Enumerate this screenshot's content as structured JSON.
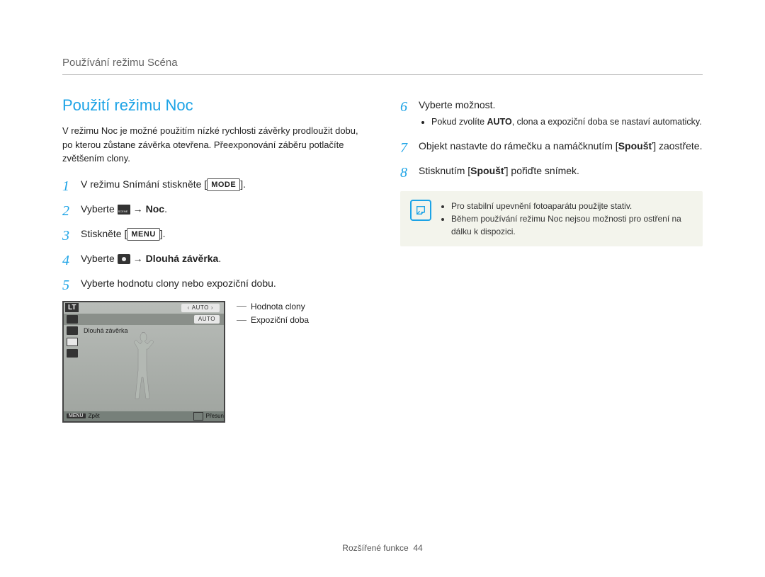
{
  "header": "Používání režimu Scéna",
  "section_title": "Použití režimu Noc",
  "intro": "V režimu Noc je možné použitím nízké rychlosti závěrky prodloužit dobu, po kterou zůstane závěrka otevřena. Přeexponování záběru potlačíte zvětšením clony.",
  "steps": {
    "s1_a": "V režimu Snímání stiskněte [",
    "s1_btn": "MODE",
    "s1_b": "].",
    "s2_a": "Vyberte ",
    "s2_target": "Noc",
    "s3_a": "Stiskněte [",
    "s3_btn": "MENU",
    "s3_b": "].",
    "s4_a": "Vyberte ",
    "s4_target": "Dlouhá závěrka",
    "s5": "Vyberte hodnotu clony nebo expoziční dobu.",
    "s6": "Vyberte možnost.",
    "s6_sub_a": "Pokud zvolíte ",
    "s6_sub_b": "AUTO",
    "s6_sub_c": ", clona a expoziční doba se nastaví automaticky.",
    "s7_a": "Objekt nastavte do rámečku a namáčknutím [",
    "s7_b": "Spoušť",
    "s7_c": "] zaostřete.",
    "s8_a": "Stisknutím [",
    "s8_b": "Spoušť",
    "s8_c": "] pořiďte snímek."
  },
  "lcd": {
    "lt": "LT",
    "auto": "AUTO",
    "long_shutter": "Dlouhá závěrka",
    "menu": "MENU",
    "back": "Zpět",
    "move": "Přesun"
  },
  "callouts": {
    "aperture": "Hodnota clony",
    "exposure": "Expoziční doba"
  },
  "notes": {
    "n1": "Pro stabilní upevnění fotoaparátu použijte stativ.",
    "n2": "Během používání režimu Noc nejsou možnosti pro ostření na dálku k dispozici."
  },
  "footer": {
    "section": "Rozšířené funkce",
    "page": "44"
  }
}
